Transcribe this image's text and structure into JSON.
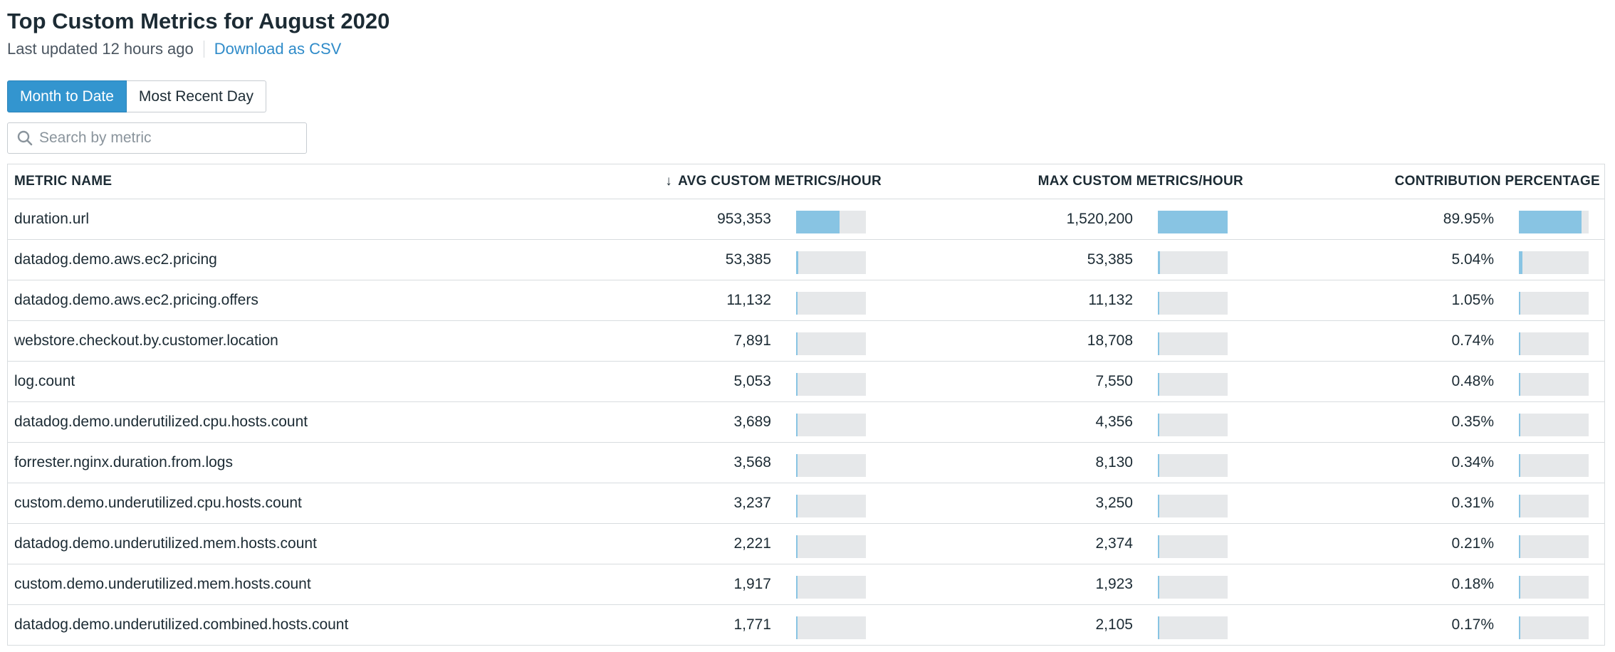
{
  "header": {
    "title": "Top Custom Metrics for August 2020",
    "last_updated": "Last updated 12 hours ago",
    "download_label": "Download as CSV"
  },
  "toggle": {
    "month_to_date": "Month to Date",
    "most_recent_day": "Most Recent Day",
    "selected": "Month to Date"
  },
  "search": {
    "placeholder": "Search by metric",
    "value": ""
  },
  "table": {
    "columns": {
      "metric_name": "METRIC NAME",
      "avg": "AVG CUSTOM METRICS/HOUR",
      "max": "MAX CUSTOM METRICS/HOUR",
      "contribution": "CONTRIBUTION PERCENTAGE"
    },
    "sort_indicator": "↓",
    "rows": [
      {
        "name": "duration.url",
        "avg": "953,353",
        "max": "1,520,200",
        "pct": "89.95%",
        "avg_bar": 0.627,
        "max_bar": 1.0,
        "pct_bar": 0.8995
      },
      {
        "name": "datadog.demo.aws.ec2.pricing",
        "avg": "53,385",
        "max": "53,385",
        "pct": "5.04%",
        "avg_bar": 0.035,
        "max_bar": 0.035,
        "pct_bar": 0.0504
      },
      {
        "name": "datadog.demo.aws.ec2.pricing.offers",
        "avg": "11,132",
        "max": "11,132",
        "pct": "1.05%",
        "avg_bar": 0.0073,
        "max_bar": 0.0073,
        "pct_bar": 0.0105
      },
      {
        "name": "webstore.checkout.by.customer.location",
        "avg": "7,891",
        "max": "18,708",
        "pct": "0.74%",
        "avg_bar": 0.0052,
        "max_bar": 0.0123,
        "pct_bar": 0.0074
      },
      {
        "name": "log.count",
        "avg": "5,053",
        "max": "7,550",
        "pct": "0.48%",
        "avg_bar": 0.0033,
        "max_bar": 0.005,
        "pct_bar": 0.0048
      },
      {
        "name": "datadog.demo.underutilized.cpu.hosts.count",
        "avg": "3,689",
        "max": "4,356",
        "pct": "0.35%",
        "avg_bar": 0.0024,
        "max_bar": 0.0029,
        "pct_bar": 0.0035
      },
      {
        "name": "forrester.nginx.duration.from.logs",
        "avg": "3,568",
        "max": "8,130",
        "pct": "0.34%",
        "avg_bar": 0.0023,
        "max_bar": 0.0053,
        "pct_bar": 0.0034
      },
      {
        "name": "custom.demo.underutilized.cpu.hosts.count",
        "avg": "3,237",
        "max": "3,250",
        "pct": "0.31%",
        "avg_bar": 0.0021,
        "max_bar": 0.0021,
        "pct_bar": 0.0031
      },
      {
        "name": "datadog.demo.underutilized.mem.hosts.count",
        "avg": "2,221",
        "max": "2,374",
        "pct": "0.21%",
        "avg_bar": 0.0015,
        "max_bar": 0.0016,
        "pct_bar": 0.0021
      },
      {
        "name": "custom.demo.underutilized.mem.hosts.count",
        "avg": "1,917",
        "max": "1,923",
        "pct": "0.18%",
        "avg_bar": 0.0013,
        "max_bar": 0.0013,
        "pct_bar": 0.0018
      },
      {
        "name": "datadog.demo.underutilized.combined.hosts.count",
        "avg": "1,771",
        "max": "2,105",
        "pct": "0.17%",
        "avg_bar": 0.0012,
        "max_bar": 0.0014,
        "pct_bar": 0.0017
      }
    ]
  },
  "colors": {
    "accent": "#3395cf",
    "link": "#2f8bc9",
    "bar_fill": "#88c4e3",
    "bar_track": "#e6e8ea"
  }
}
